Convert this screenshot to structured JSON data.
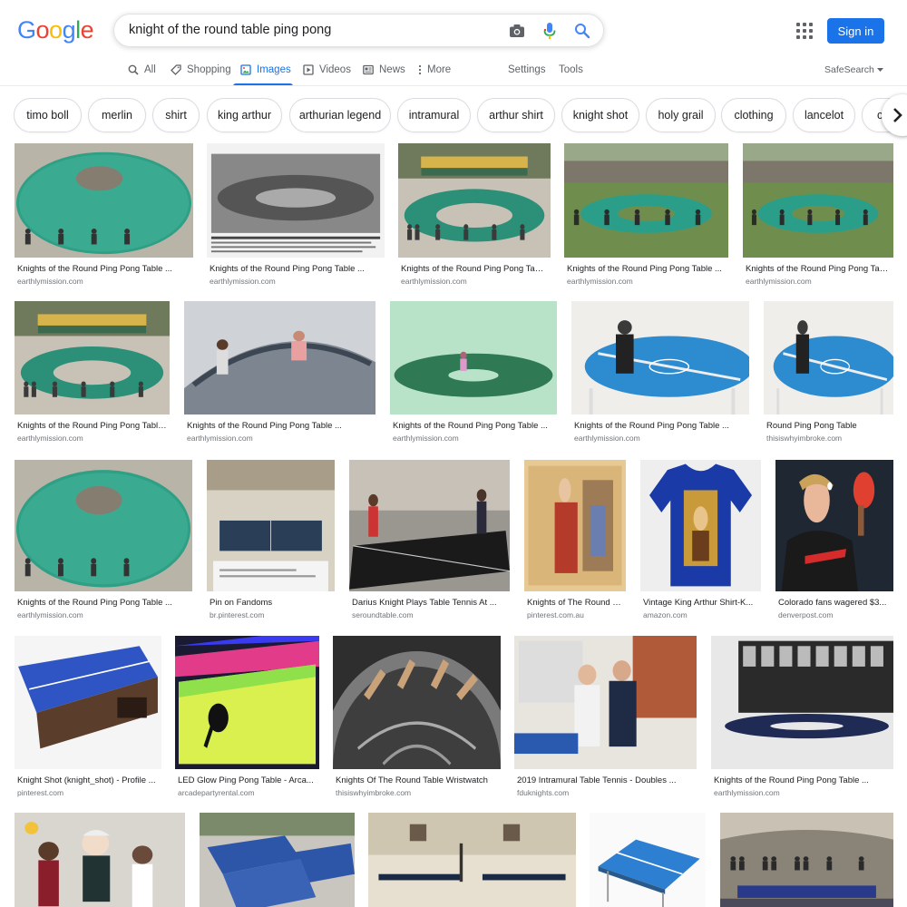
{
  "header": {
    "logo_letters": [
      "G",
      "o",
      "o",
      "g",
      "l",
      "e"
    ],
    "logo_colors": [
      "#4285f4",
      "#ea4335",
      "#fbbc05",
      "#4285f4",
      "#34a853",
      "#ea4335"
    ],
    "search_query": "knight of the round table ping pong",
    "signin_label": "Sign in"
  },
  "tabs": {
    "all": "All",
    "shopping": "Shopping",
    "images": "Images",
    "videos": "Videos",
    "news": "News",
    "more": "More",
    "settings": "Settings",
    "tools": "Tools",
    "safesearch": "SafeSearch"
  },
  "chips": [
    "timo boll",
    "merlin",
    "shirt",
    "king arthur",
    "arthurian legend",
    "intramural",
    "arthur shirt",
    "knight shot",
    "holy grail",
    "clothing",
    "lancelot",
    "c"
  ],
  "results": [
    {
      "title": "Knights of the Round Ping Pong Table ...",
      "source": "earthlymission.com",
      "scene": "green-ring-aerial"
    },
    {
      "title": "Knights of the Round Ping Pong Table ...",
      "source": "earthlymission.com",
      "scene": "newspaper"
    },
    {
      "title": "Knights of the Round Ping Pong Table ...",
      "source": "earthlymission.com",
      "scene": "green-ring-street"
    },
    {
      "title": "Knights of the Round Ping Pong Table ...",
      "source": "earthlymission.com",
      "scene": "green-ring-garden"
    },
    {
      "title": "Knights of the Round Ping Pong Table ...",
      "source": "earthlymission.com",
      "scene": "green-ring-garden"
    },
    {
      "title": "Knights of the Round Ping Pong Table ...",
      "source": "earthlymission.com",
      "scene": "green-ring-street"
    },
    {
      "title": "Knights of the Round Ping Pong Table ...",
      "source": "earthlymission.com",
      "scene": "grey-ring-players"
    },
    {
      "title": "Knights of the Round Ping Pong Table ...",
      "source": "earthlymission.com",
      "scene": "green-studio"
    },
    {
      "title": "Knights of the Round Ping Pong Table ...",
      "source": "earthlymission.com",
      "scene": "blue-round"
    },
    {
      "title": "Round Ping Pong Table",
      "source": "thisiswhyimbroke.com",
      "scene": "blue-round"
    },
    {
      "title": "Knights of the Round Ping Pong Table ...",
      "source": "earthlymission.com",
      "scene": "green-ring-aerial"
    },
    {
      "title": "Pin on Fandoms",
      "source": "br.pinterest.com",
      "scene": "office-table"
    },
    {
      "title": "Darius Knight Plays Table Tennis At ...",
      "source": "seroundtable.com",
      "scene": "dark-office"
    },
    {
      "title": "Knights of The Round T...",
      "source": "pinterest.com.au",
      "scene": "painting"
    },
    {
      "title": "Vintage King Arthur Shirt-K...",
      "source": "amazon.com",
      "scene": "tshirt"
    },
    {
      "title": "Colorado fans wagered $3...",
      "source": "denverpost.com",
      "scene": "player"
    },
    {
      "title": "Knight Shot (knight_shot) - Profile ...",
      "source": "pinterest.com",
      "scene": "blue-table"
    },
    {
      "title": "LED Glow Ping Pong Table - Arca...",
      "source": "arcadepartyrental.com",
      "scene": "led-table"
    },
    {
      "title": "Knights Of The Round Table Wristwatch",
      "source": "thisiswhyimbroke.com",
      "scene": "watch"
    },
    {
      "title": "2019 Intramural Table Tennis - Doubles ...",
      "source": "fduknights.com",
      "scene": "two-men"
    },
    {
      "title": "Knights of the Round Ping Pong Table ...",
      "source": "earthlymission.com",
      "scene": "gallery-ring"
    },
    {
      "title": "",
      "source": "",
      "scene": "crowd"
    },
    {
      "title": "",
      "source": "",
      "scene": "outdoor-tables"
    },
    {
      "title": "",
      "source": "",
      "scene": "room-tables"
    },
    {
      "title": "",
      "source": "",
      "scene": "blue-table-white"
    },
    {
      "title": "",
      "source": "",
      "scene": "hall-crowd"
    }
  ]
}
